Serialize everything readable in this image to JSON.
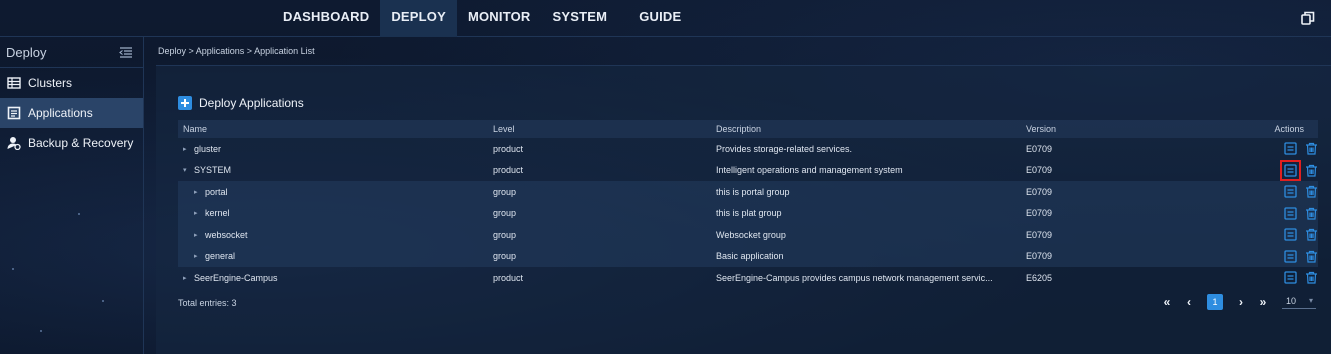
{
  "topnav": {
    "items": [
      "DASHBOARD",
      "DEPLOY",
      "MONITOR",
      "SYSTEM",
      "GUIDE"
    ],
    "active": "DEPLOY",
    "right_icon": "copy-icon"
  },
  "sidebar": {
    "title": "Deploy",
    "items": [
      {
        "label": "Clusters",
        "icon": "clusters-icon"
      },
      {
        "label": "Applications",
        "icon": "applications-icon"
      },
      {
        "label": "Backup & Recovery",
        "icon": "backup-user-icon"
      }
    ],
    "active": "Applications"
  },
  "breadcrumb": "Deploy > Applications > Application List",
  "section_title": "Deploy Applications",
  "table": {
    "headers": {
      "name": "Name",
      "level": "Level",
      "description": "Description",
      "version": "Version",
      "actions": "Actions"
    },
    "rows": [
      {
        "name": "gluster",
        "level": "product",
        "description": "Provides storage-related services.",
        "version": "E0709"
      },
      {
        "name": "SYSTEM",
        "level": "product",
        "description": "Intelligent operations and management system",
        "version": "E0709"
      },
      {
        "name": "portal",
        "level": "group",
        "description": "this is portal group",
        "version": "E0709"
      },
      {
        "name": "kernel",
        "level": "group",
        "description": "this is plat group",
        "version": "E0709"
      },
      {
        "name": "websocket",
        "level": "group",
        "description": "Websocket group",
        "version": "E0709"
      },
      {
        "name": "general",
        "level": "group",
        "description": "Basic application",
        "version": "E0709"
      },
      {
        "name": "SeerEngine-Campus",
        "level": "product",
        "description": "SeerEngine-Campus provides campus network management servic...",
        "version": "E6205"
      }
    ]
  },
  "footer": {
    "total": "Total entries: 3",
    "current_page": "1",
    "page_size": "10"
  },
  "colors": {
    "accent": "#2e8de0",
    "highlight": "#e02020"
  }
}
